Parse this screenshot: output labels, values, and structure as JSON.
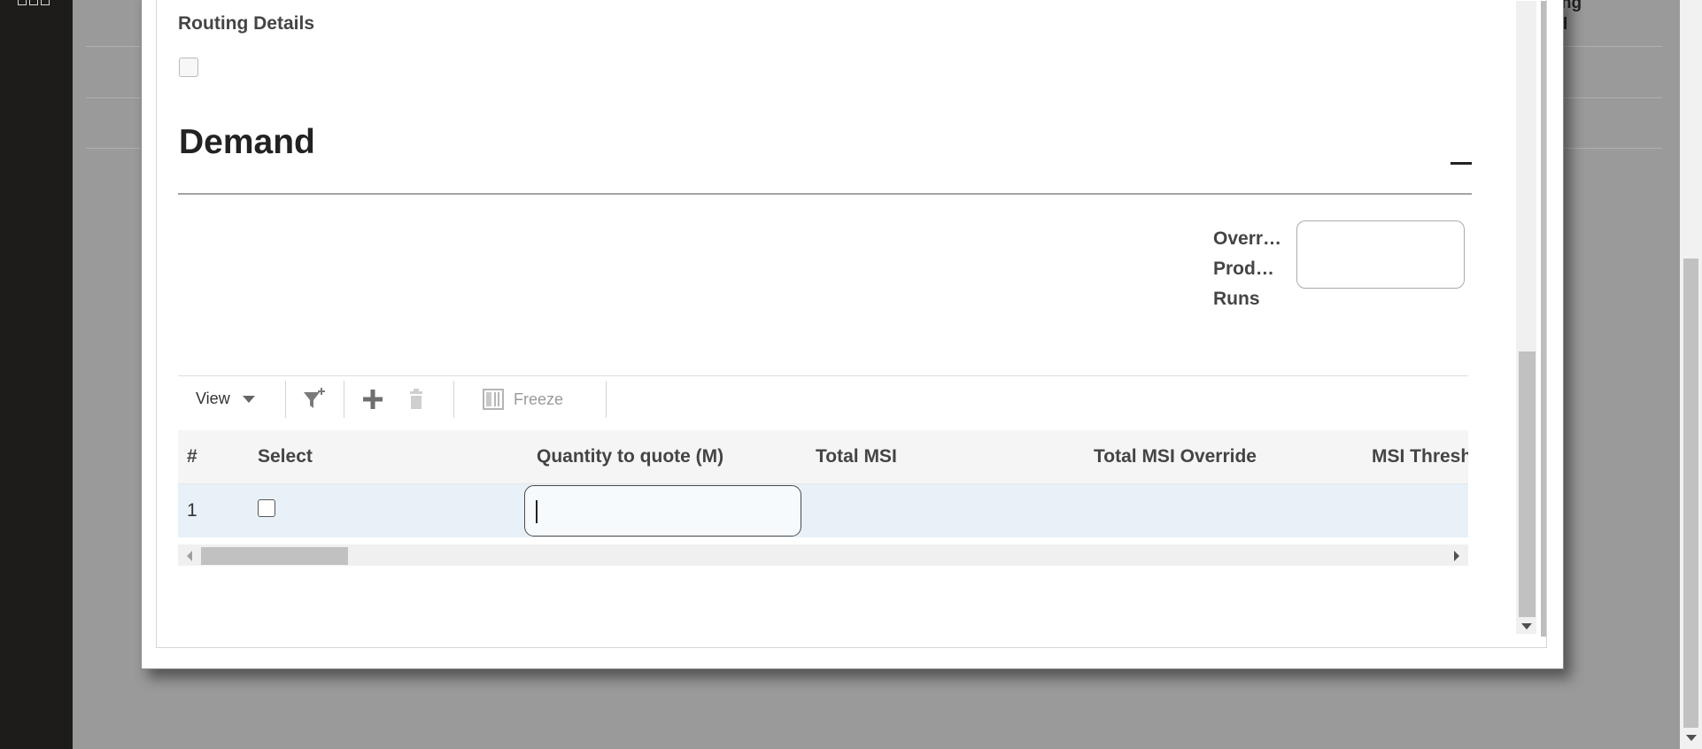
{
  "dialog": {
    "routing_section": {
      "title": "Routing Details"
    },
    "demand_section": {
      "title": "Demand",
      "override_field": {
        "label_lines": [
          "Overr…",
          "Prod…",
          "Runs"
        ],
        "value": ""
      }
    },
    "toolbar": {
      "view_label": "View",
      "freeze_label": "Freeze"
    },
    "grid": {
      "columns": [
        "#",
        "Select",
        "Quantity to quote (M)",
        "Total MSI",
        "Total MSI Override",
        "MSI Thresh"
      ],
      "rows": [
        {
          "number": "1",
          "selected": false,
          "quantity": "",
          "total_msi": "",
          "total_msi_override": "",
          "msi_threshold": ""
        }
      ]
    }
  },
  "background": {
    "column_label_lines": [
      "cing",
      "od"
    ]
  },
  "icons": {
    "menu": "app-menu-icon",
    "filter": "filter-add-icon",
    "add": "plus-icon",
    "delete": "trash-icon",
    "freeze": "freeze-columns-icon",
    "collapse": "collapse-minus-icon"
  }
}
